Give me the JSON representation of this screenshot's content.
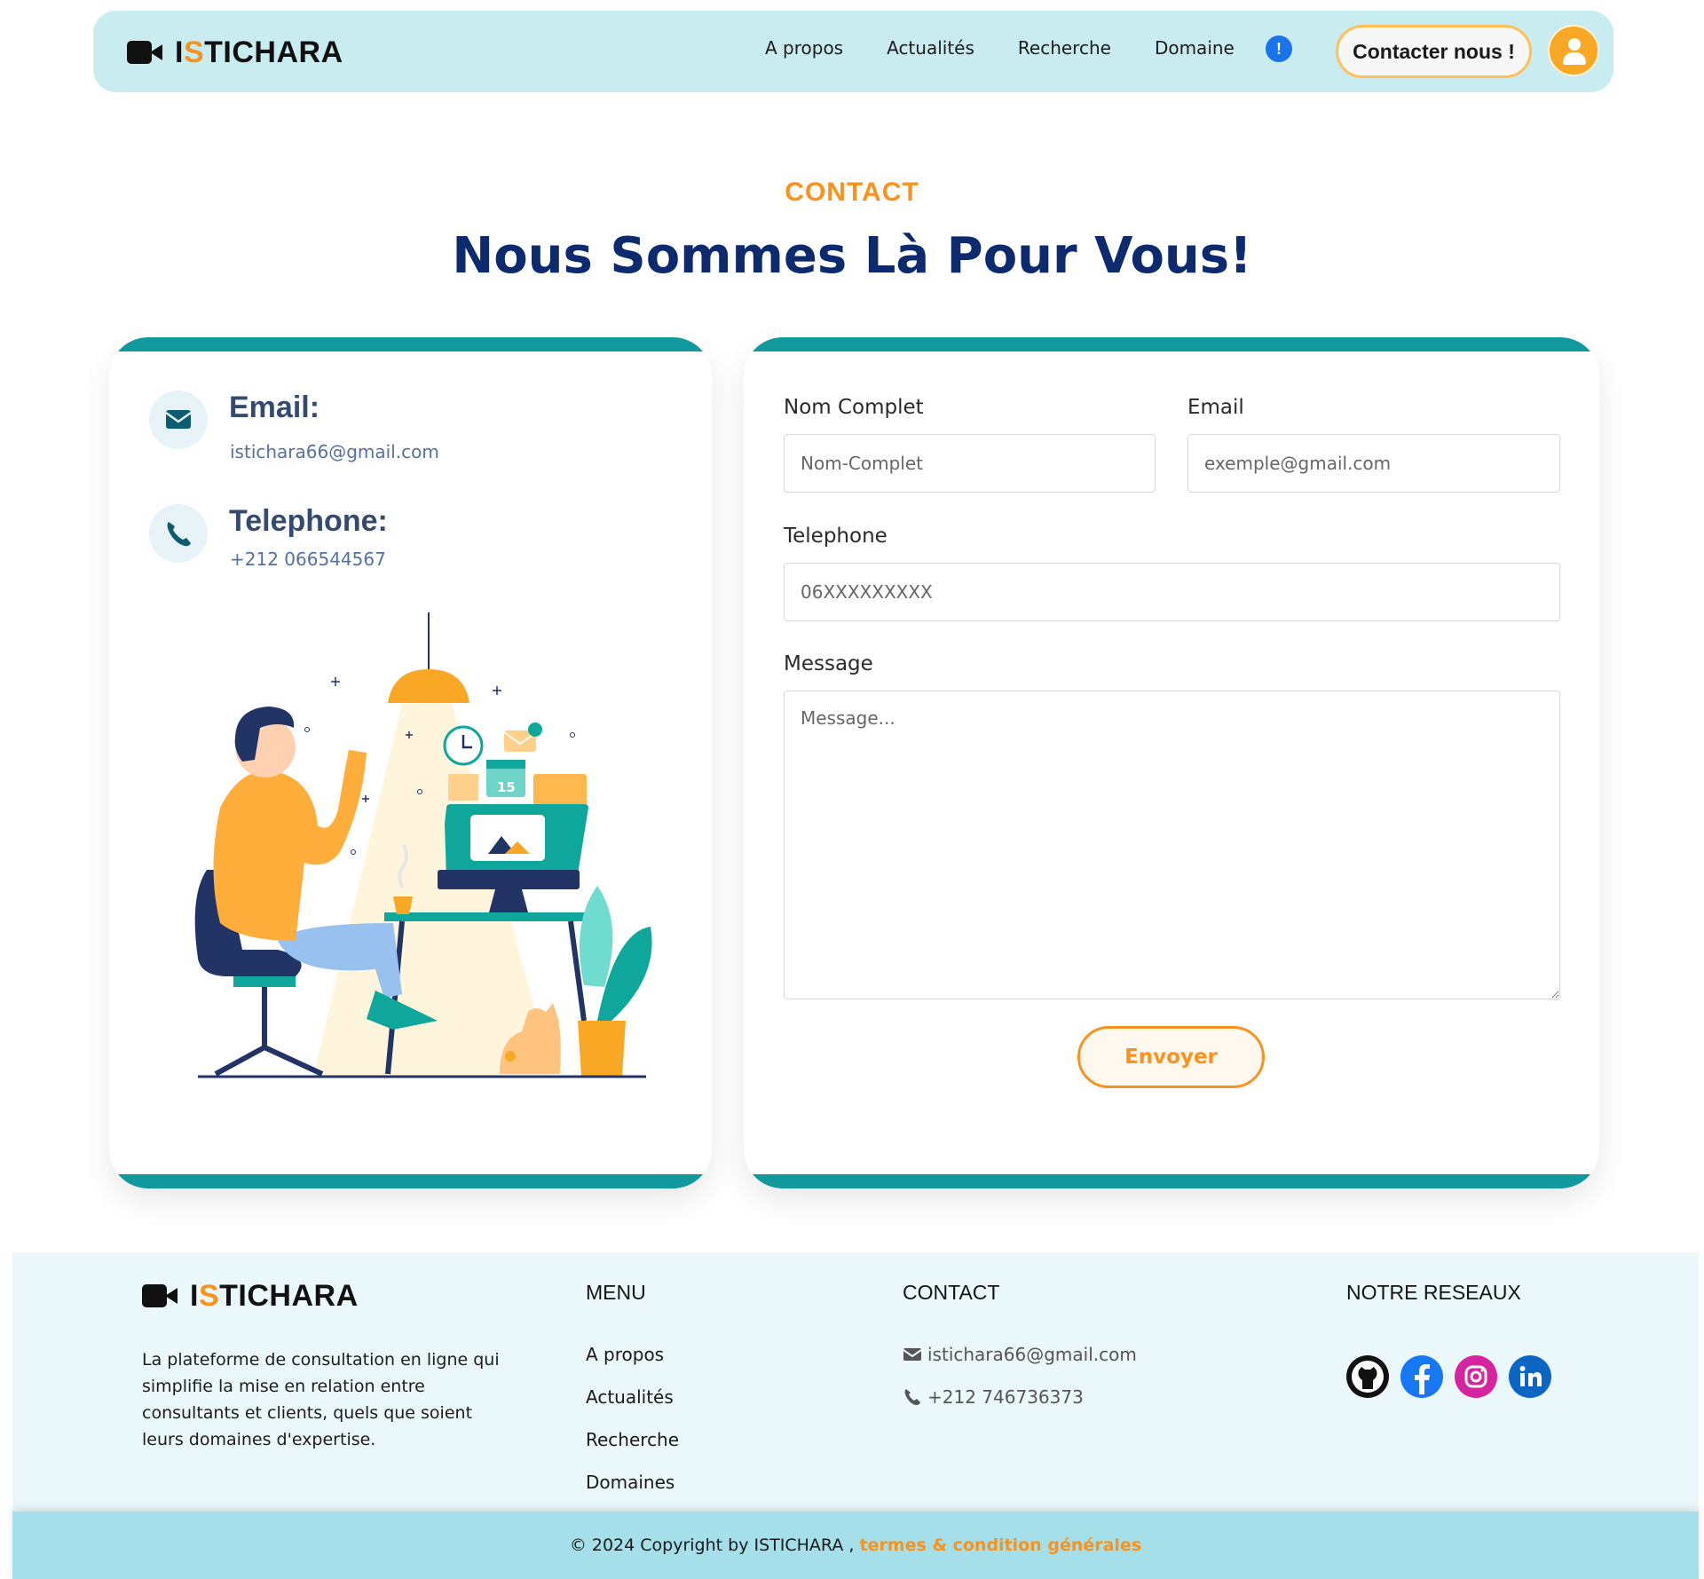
{
  "navbar": {
    "brand_prefix": "I",
    "brand_accent": "S",
    "brand_rest": "TICHARA",
    "links": [
      "A propos",
      "Actualités",
      "Recherche",
      "Domaine"
    ],
    "info_icon": "!",
    "contact_button": "Contacter nous !"
  },
  "hero": {
    "label": "CONTACT",
    "title": "Nous Sommes Là Pour Vous!"
  },
  "info": {
    "email_heading": "Email:",
    "email_value": "istichara66@gmail.com",
    "phone_heading": "Telephone:",
    "phone_value": "+212 066544567"
  },
  "form": {
    "name_label": "Nom Complet",
    "name_placeholder": "Nom-Complet",
    "email_label": "Email",
    "email_placeholder": "exemple@gmail.com",
    "phone_label": "Telephone",
    "phone_placeholder": "06XXXXXXXXX",
    "message_label": "Message",
    "message_placeholder": "Message...",
    "submit": "Envoyer"
  },
  "footer": {
    "brand_prefix": "I",
    "brand_accent": "S",
    "brand_rest": "TICHARA",
    "description": "La plateforme de consultation en ligne qui simplifie la mise en relation entre consultants et clients, quels que soient leurs domaines d'expertise.",
    "menu_title": "MENU",
    "menu_items": [
      "A propos",
      "Actualités",
      "Recherche",
      "Domaines"
    ],
    "contact_title": "CONTACT",
    "contact_email": "istichara66@gmail.com",
    "contact_phone": "+212 746736373",
    "social_title": "NOTRE RESEAUX",
    "socials": [
      "github-icon",
      "facebook-icon",
      "instagram-icon",
      "linkedin-icon"
    ],
    "copyright_text": "© 2024 Copyright by ISTICHARA ,",
    "terms_link": "termes & condition générales"
  },
  "colors": {
    "accent_orange": "#f7931e",
    "teal": "#11999e",
    "navy_title": "#0d2a6e",
    "nav_bg": "#c9ecf0",
    "footer_bg": "#eaf7fb",
    "copyright_bg": "#a5dfea"
  }
}
